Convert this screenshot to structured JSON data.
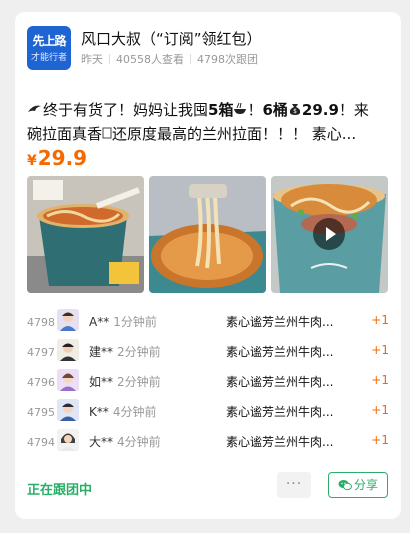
{
  "header": {
    "title": "风口大叔（“订阅”领红包）",
    "logo_text_1": "先上路",
    "logo_text_2": "才能行者",
    "meta": {
      "date": "昨天",
      "views": "40558人查看",
      "orders": "4798次跟团"
    }
  },
  "post": {
    "description_prefix": "终于有货了！妈妈让我囤",
    "description_bold1": "5箱",
    "description_mid": "！",
    "description_bold2": "6桶",
    "description_price_icon": "money-bag-icon",
    "description_bold3": "29.9",
    "description_rest": "！来碗拉面真香",
    "description_end": "还原度最高的兰州拉面！！！ 素心...",
    "price_currency": "¥",
    "price_value": "29.9",
    "images": [
      {
        "name": "noodle-cup-photo-1",
        "has_play": false
      },
      {
        "name": "noodle-fork-photo-2",
        "has_play": false
      },
      {
        "name": "noodle-bowl-video-3",
        "has_play": true
      }
    ]
  },
  "orders": [
    {
      "num": "4798",
      "name": "A**",
      "time": "1分钟前",
      "product": "素心谧芳兰州牛肉...",
      "qty": "+1"
    },
    {
      "num": "4797",
      "name": "建**",
      "time": "2分钟前",
      "product": "素心谧芳兰州牛肉...",
      "qty": "+1"
    },
    {
      "num": "4796",
      "name": "如**",
      "time": "2分钟前",
      "product": "素心谧芳兰州牛肉...",
      "qty": "+1"
    },
    {
      "num": "4795",
      "name": "K**",
      "time": "4分钟前",
      "product": "素心谧芳兰州牛肉...",
      "qty": "+1"
    },
    {
      "num": "4794",
      "name": "大**",
      "time": "4分钟前",
      "product": "素心谧芳兰州牛肉...",
      "qty": "+1"
    }
  ],
  "footer": {
    "status": "正在跟团中",
    "more_label": "···",
    "share_label": "分享"
  },
  "colors": {
    "accent": "#f56a00",
    "green": "#2aae67",
    "logo_bg": "#1f64d3"
  }
}
